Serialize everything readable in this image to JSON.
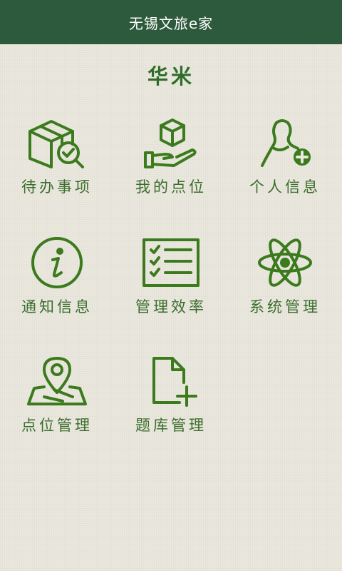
{
  "app": {
    "title": "无锡文旅e家"
  },
  "page": {
    "title": "华米"
  },
  "colors": {
    "header": "#2d5a3c",
    "accent": "#3c7a1e",
    "background": "#ebe8de"
  },
  "menu": [
    {
      "label": "待办事项",
      "icon": "package-check-icon"
    },
    {
      "label": "我的点位",
      "icon": "hand-package-icon"
    },
    {
      "label": "个人信息",
      "icon": "person-add-icon"
    },
    {
      "label": "通知信息",
      "icon": "info-icon"
    },
    {
      "label": "管理效率",
      "icon": "checklist-icon"
    },
    {
      "label": "系统管理",
      "icon": "atom-icon"
    },
    {
      "label": "点位管理",
      "icon": "map-pin-icon"
    },
    {
      "label": "题库管理",
      "icon": "document-add-icon"
    }
  ]
}
